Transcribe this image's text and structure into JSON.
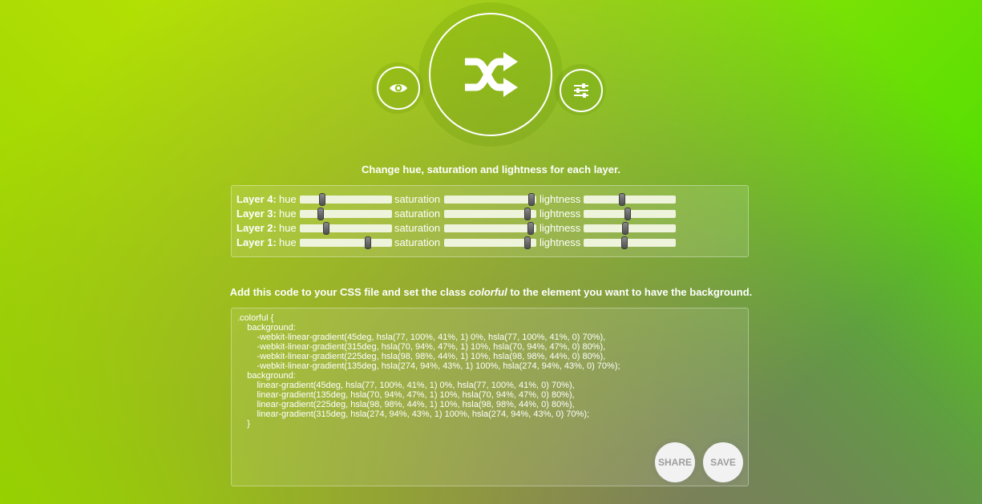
{
  "toolbar": {
    "preview_icon": "eye-icon",
    "shuffle_icon": "shuffle-icon",
    "settings_icon": "sliders-icon"
  },
  "layers_heading": "Change hue, saturation and lightness for each layer.",
  "labels": {
    "hue": "hue",
    "saturation": "saturation",
    "lightness": "lightness"
  },
  "layers": [
    {
      "name": "Layer 4:",
      "hue": 0.24,
      "saturation": 0.95,
      "lightness": 0.42
    },
    {
      "name": "Layer 3:",
      "hue": 0.23,
      "saturation": 0.9,
      "lightness": 0.48
    },
    {
      "name": "Layer 2:",
      "hue": 0.29,
      "saturation": 0.94,
      "lightness": 0.45
    },
    {
      "name": "Layer 1:",
      "hue": 0.74,
      "saturation": 0.9,
      "lightness": 0.44
    }
  ],
  "code_heading": {
    "before": "Add this code to your CSS file and set the class ",
    "emphasis": "colorful",
    "after": " to the element you want to have the background."
  },
  "code_text": ".colorful {\n\tbackground:\n\t\t-webkit-linear-gradient(45deg, hsla(77, 100%, 41%, 1) 0%, hsla(77, 100%, 41%, 0) 70%),\n\t\t-webkit-linear-gradient(315deg, hsla(70, 94%, 47%, 1) 10%, hsla(70, 94%, 47%, 0) 80%),\n\t\t-webkit-linear-gradient(225deg, hsla(98, 98%, 44%, 1) 10%, hsla(98, 98%, 44%, 0) 80%),\n\t\t-webkit-linear-gradient(135deg, hsla(274, 94%, 43%, 1) 100%, hsla(274, 94%, 43%, 0) 70%);\n\tbackground:\n\t\tlinear-gradient(45deg, hsla(77, 100%, 41%, 1) 0%, hsla(77, 100%, 41%, 0) 70%),\n\t\tlinear-gradient(135deg, hsla(70, 94%, 47%, 1) 10%, hsla(70, 94%, 47%, 0) 80%),\n\t\tlinear-gradient(225deg, hsla(98, 98%, 44%, 1) 10%, hsla(98, 98%, 44%, 0) 80%),\n\t\tlinear-gradient(315deg, hsla(274, 94%, 43%, 1) 100%, hsla(274, 94%, 43%, 0) 70%);\n\t}",
  "actions": {
    "share": "SHARE",
    "save": "SAVE"
  }
}
